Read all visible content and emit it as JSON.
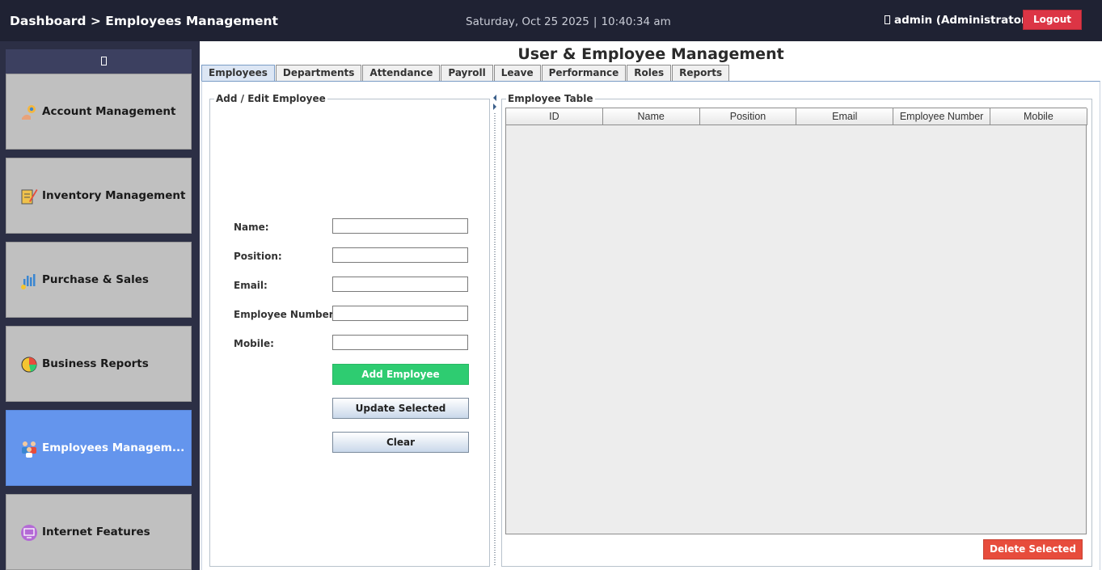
{
  "header": {
    "breadcrumb": "Dashboard > Employees Management",
    "date": "Saturday, Oct 25 2025",
    "time_separator": "|",
    "time": "10:40:34 am",
    "user": "admin (Administrator)",
    "logout_label": "Logout"
  },
  "sidebar": {
    "items": [
      {
        "label": "Account Management",
        "icon": "account-icon",
        "active": false
      },
      {
        "label": "Inventory Management",
        "icon": "inventory-icon",
        "active": false
      },
      {
        "label": "Purchase & Sales",
        "icon": "purchase-sales-icon",
        "active": false
      },
      {
        "label": "Business Reports",
        "icon": "reports-icon",
        "active": false
      },
      {
        "label": "Employees Managem...",
        "icon": "employees-icon",
        "active": true
      },
      {
        "label": "Internet Features",
        "icon": "internet-icon",
        "active": false
      }
    ]
  },
  "main": {
    "title": "User & Employee Management",
    "tabs": [
      "Employees",
      "Departments",
      "Attendance",
      "Payroll",
      "Leave",
      "Performance",
      "Roles",
      "Reports"
    ],
    "active_tab": "Employees",
    "form": {
      "title": "Add / Edit Employee",
      "fields": [
        {
          "label": "Name:",
          "value": ""
        },
        {
          "label": "Position:",
          "value": ""
        },
        {
          "label": "Email:",
          "value": ""
        },
        {
          "label": "Employee Number:",
          "value": ""
        },
        {
          "label": "Mobile:",
          "value": ""
        }
      ],
      "add_label": "Add Employee",
      "update_label": "Update Selected",
      "clear_label": "Clear"
    },
    "table": {
      "title": "Employee Table",
      "columns": [
        "ID",
        "Name",
        "Position",
        "Email",
        "Employee Number",
        "Mobile"
      ],
      "rows": [],
      "delete_label": "Delete Selected"
    }
  },
  "colors": {
    "header_bg": "#1f2233",
    "sidebar_bg": "#2c2f45",
    "nav_item_bg": "#c0c0c0",
    "nav_active_bg": "#6495ed",
    "logout": "#dc3545",
    "add_button": "#2ecc71",
    "delete_button": "#e74c3c"
  }
}
